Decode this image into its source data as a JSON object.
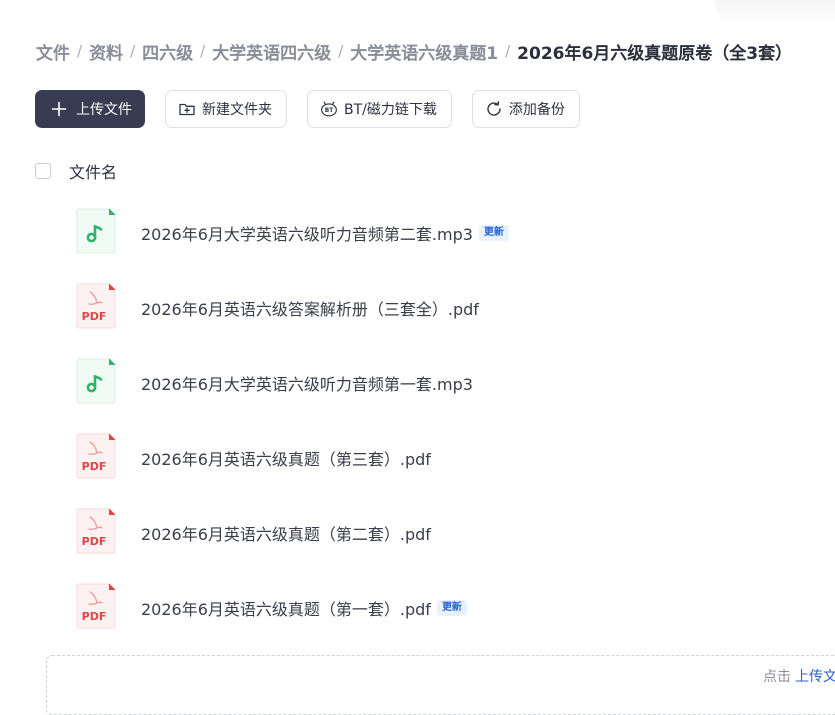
{
  "breadcrumb": {
    "items": [
      "文件",
      "资料",
      "四六级",
      "大学英语四六级",
      "大学英语六级真题1"
    ],
    "current": "2026年6月六级真题原卷（全3套）",
    "separator": "/"
  },
  "toolbar": {
    "upload_label": "上传文件",
    "new_folder_label": "新建文件夹",
    "bt_label": "BT/磁力链下载",
    "backup_label": "添加备份"
  },
  "list": {
    "header_name": "文件名",
    "files": [
      {
        "name": "2026年6月大学英语六级听力音频第二套.mp3",
        "type": "audio",
        "badge": "更新"
      },
      {
        "name": "2026年6月英语六级答案解析册（三套全）.pdf",
        "type": "pdf",
        "badge": ""
      },
      {
        "name": "2026年6月大学英语六级听力音频第一套.mp3",
        "type": "audio",
        "badge": ""
      },
      {
        "name": "2026年6月英语六级真题（第三套）.pdf",
        "type": "pdf",
        "badge": ""
      },
      {
        "name": "2026年6月英语六级真题（第二套）.pdf",
        "type": "pdf",
        "badge": ""
      },
      {
        "name": "2026年6月英语六级真题（第一套）.pdf",
        "type": "pdf",
        "badge": "更新"
      }
    ]
  },
  "drop_zone": {
    "hint_prefix": "点击",
    "hint_link": "上传文"
  },
  "icons": {
    "pdf_label": "PDF",
    "bt_glyph": "BT"
  },
  "colors": {
    "primary_button": "#393b52",
    "badge_text": "#2563d6",
    "badge_bg": "#e9f1fe",
    "pdf_red": "#e04646",
    "audio_green": "#2fb36b"
  }
}
